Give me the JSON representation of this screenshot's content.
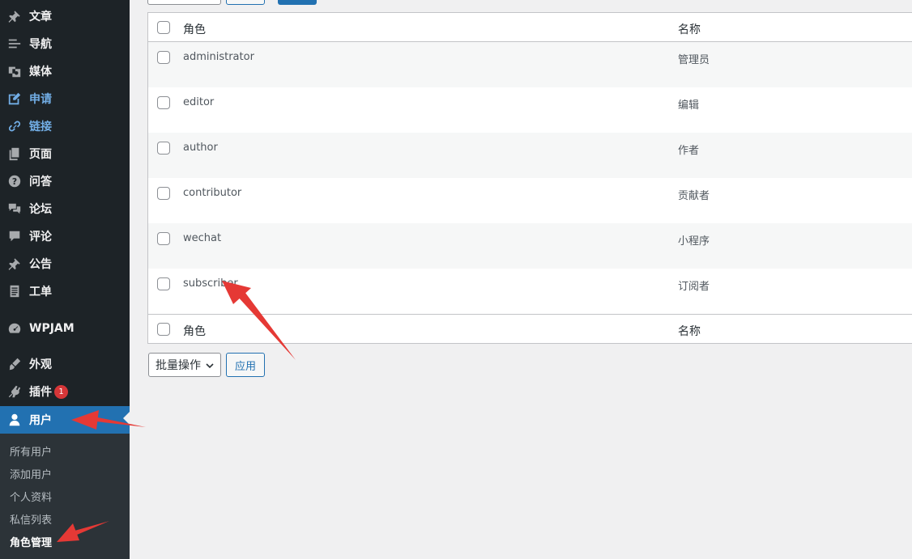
{
  "sidebar": {
    "items": [
      {
        "label": "文章",
        "icon": "pushpin-icon"
      },
      {
        "label": "导航",
        "icon": "menu-lines-icon"
      },
      {
        "label": "媒体",
        "icon": "media-icon"
      },
      {
        "label": "申请",
        "icon": "edit-icon"
      },
      {
        "label": "链接",
        "icon": "link-icon"
      },
      {
        "label": "页面",
        "icon": "pages-icon"
      },
      {
        "label": "问答",
        "icon": "question-icon"
      },
      {
        "label": "论坛",
        "icon": "forum-icon"
      },
      {
        "label": "评论",
        "icon": "comment-icon"
      },
      {
        "label": "公告",
        "icon": "pushpin-icon"
      },
      {
        "label": "工单",
        "icon": "document-icon"
      },
      {
        "label": "WPJAM",
        "icon": "dashboard-gauge-icon"
      },
      {
        "label": "外观",
        "icon": "brush-icon"
      },
      {
        "label": "插件",
        "icon": "plugin-icon",
        "badge": "1"
      },
      {
        "label": "用户",
        "icon": "user-icon"
      }
    ],
    "submenu": [
      "所有用户",
      "添加用户",
      "个人资料",
      "私信列表",
      "角色管理"
    ]
  },
  "table": {
    "col_role": "角色",
    "col_name": "名称",
    "rows": [
      {
        "role": "administrator",
        "name": "管理员"
      },
      {
        "role": "editor",
        "name": "编辑"
      },
      {
        "role": "author",
        "name": "作者"
      },
      {
        "role": "contributor",
        "name": "贡献者"
      },
      {
        "role": "wechat",
        "name": "小程序"
      },
      {
        "role": "subscriber",
        "name": "订阅者"
      }
    ]
  },
  "actions": {
    "bulk_label": "批量操作",
    "apply_label": "应用"
  },
  "colors": {
    "sidebar_bg": "#1d2327",
    "accent": "#2271b1",
    "annotation": "#e53935"
  }
}
